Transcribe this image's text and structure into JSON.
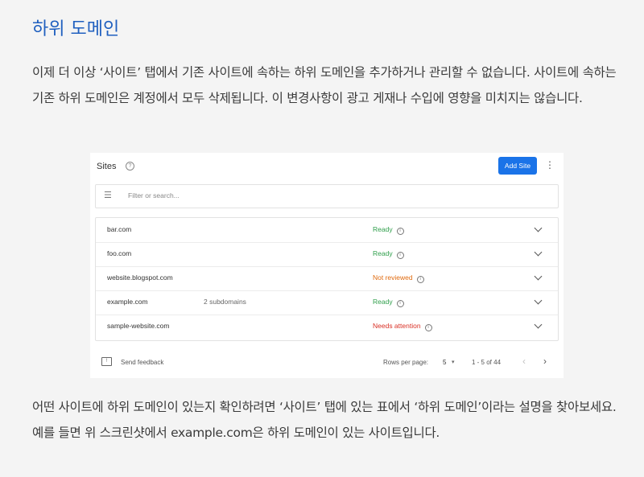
{
  "heading": "하위 도메인",
  "paragraph1": "이제 더 이상 ‘사이트’ 탭에서 기존 사이트에 속하는 하위 도메인을 추가하거나 관리할 수 없습니다. 사이트에 속하는 기존 하위 도메인은 계정에서 모두 삭제됩니다. 이 변경사항이 광고 게재나 수입에 영향을 미치지는 않습니다.",
  "paragraph2": "어떤 사이트에 하위 도메인이 있는지 확인하려면 ‘사이트’ 탭에 있는 표에서 ‘하위 도메인’이라는 설명을 찾아보세요. 예를 들면 위 스크린샷에서 example.com은 하위 도메인이 있는 사이트입니다.",
  "screenshot": {
    "title": "Sites",
    "help_glyph": "?",
    "add_site_label": "Add Site",
    "more_glyph": "⋮",
    "filter_placeholder": "Filter or search...",
    "filter_glyph": "☰",
    "info_glyph": "i",
    "rows": [
      {
        "domain": "bar.com",
        "subdomains": "",
        "status": "Ready"
      },
      {
        "domain": "foo.com",
        "subdomains": "",
        "status": "Ready"
      },
      {
        "domain": "website.blogspot.com",
        "subdomains": "",
        "status": "Not reviewed"
      },
      {
        "domain": "example.com",
        "subdomains": "2 subdomains",
        "status": "Ready"
      },
      {
        "domain": "sample-website.com",
        "subdomains": "",
        "status": "Needs attention"
      }
    ],
    "colors": {
      "ready": "#2e9e4a",
      "not_reviewed": "#e06b10",
      "needs_attention": "#d93025",
      "accent": "#1a73e8"
    },
    "footer": {
      "feedback_label": "Send feedback",
      "feedback_glyph": "!",
      "rows_per_page_label": "Rows per page:",
      "rows_per_page_value": "5",
      "caret_glyph": "▾",
      "range": "1 - 5 of 44",
      "prev_glyph": "‹",
      "next_glyph": "›"
    }
  }
}
